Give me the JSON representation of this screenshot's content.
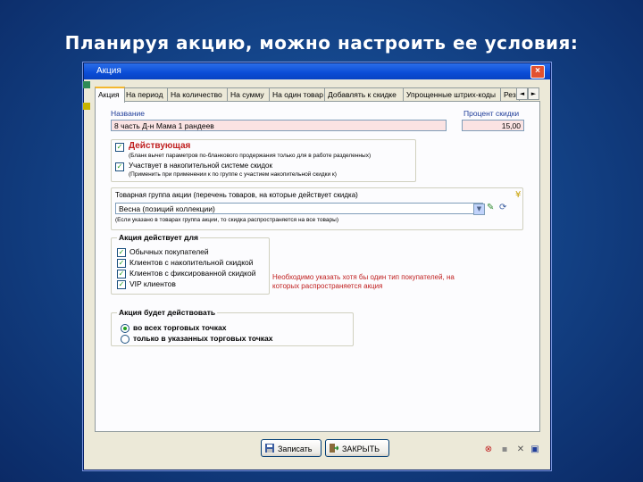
{
  "slide": {
    "title": "Планируя акцию, можно настроить ее условия:"
  },
  "window": {
    "title": "Акция",
    "close_label": "×"
  },
  "tabs": [
    {
      "label": "Акция"
    },
    {
      "label": "На период"
    },
    {
      "label": "На количество"
    },
    {
      "label": "На сумму"
    },
    {
      "label": "На один товар"
    },
    {
      "label": "Добавлять к скидке"
    },
    {
      "label": "Упрощенные штрих-коды"
    },
    {
      "label": "Рез"
    }
  ],
  "tab_scroll": {
    "left": "◄",
    "right": "►"
  },
  "form": {
    "name_label": "Название",
    "name_value": "8 часть Д-н Мама 1 рандеев",
    "discount_label": "Процент скидки",
    "discount_value": "15,00",
    "active": {
      "label": "Действующая",
      "checked": true,
      "hint": "(Бланк вычет параметров по-бланкового продержания только для в работе разделенных)"
    },
    "accumulative": {
      "label": "Участвует в накопительной системе скидок",
      "checked": true,
      "hint": "(Применить при применении к по группе с участием накопительной скидки к)"
    },
    "group_label": "Товарная группа акции (перечень товаров, на которые действует скидка)",
    "group_value": "Весна (позиций коллекции)",
    "group_hint": "(Если указано в товарах группа акции, то скидка распространяется на все товары)",
    "group_dropdown": "▼"
  },
  "applies_to": {
    "title": "Акция действует для",
    "items": [
      {
        "label": "Обычных покупателей",
        "checked": true
      },
      {
        "label": "Клиентов с накопительной скидкой",
        "checked": true
      },
      {
        "label": "Клиентов с фиксированной скидкой",
        "checked": true
      },
      {
        "label": "VIP клиентов",
        "checked": true
      }
    ],
    "warning": "Необходимо указать хотя бы один тип покупателей, на которых распространяется акция"
  },
  "stores": {
    "title": "Акция будет действовать",
    "options": [
      {
        "label": "во всех торговых точках",
        "selected": true
      },
      {
        "label": "только в указанных торговых точках",
        "selected": false
      }
    ]
  },
  "footer": {
    "save_label": "Записать",
    "close_label": "ЗАКРЫТЬ"
  },
  "icons": {
    "checkmark": "✓",
    "accent": "#f3b72f",
    "title_bar": "#0a4cd6"
  }
}
